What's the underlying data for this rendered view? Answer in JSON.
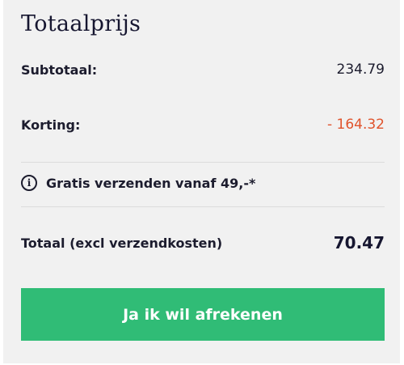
{
  "summary": {
    "title": "Totaalprijs",
    "subtotal_label": "Subtotaal:",
    "subtotal_value": "234.79",
    "discount_label": "Korting:",
    "discount_value": "- 164.32",
    "shipping_notice": "Gratis verzenden vanaf 49,-*",
    "total_label": "Totaal (excl verzendkosten)",
    "total_value": "70.47",
    "checkout_button": "Ja ik wil afrekenen"
  },
  "icons": {
    "info": "info-circle-icon"
  },
  "colors": {
    "discount": "#e0532c",
    "button": "#30bc76",
    "panel": "#f1f1f1",
    "text": "#1c1c2e"
  }
}
